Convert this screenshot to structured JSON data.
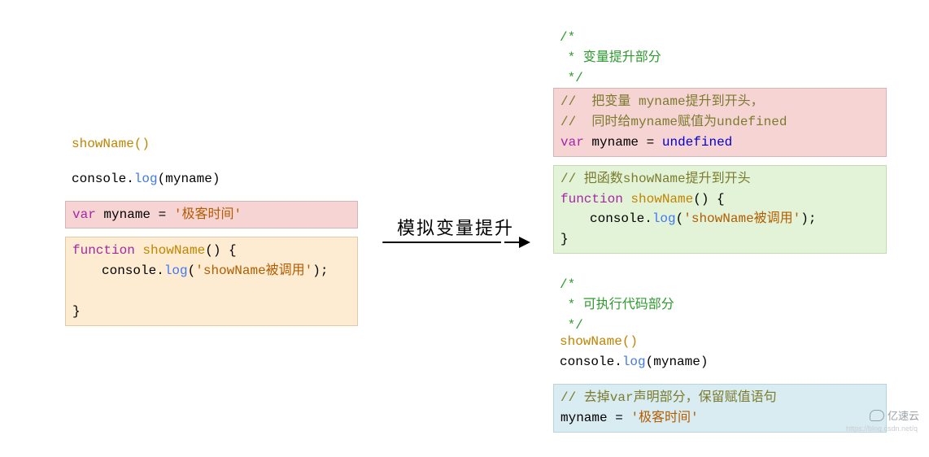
{
  "arrow_label": "模拟变量提升",
  "left": {
    "call1": "showName()",
    "log": {
      "prefix": "console",
      "method": "log",
      "arg": "myname"
    },
    "var_line": {
      "kw": "var",
      "name": "myname",
      "eq": "=",
      "str": "'极客时间'"
    },
    "func": {
      "kw": "function",
      "name": "showName",
      "open": "() {",
      "body_prefix": "console",
      "body_method": "log",
      "body_arg": "'showName被调用'",
      "close": "}"
    }
  },
  "right": {
    "hoist_comment": {
      "l1": "/*",
      "l2": " * 变量提升部分",
      "l3": " */"
    },
    "pink": {
      "c1": "//  把变量 myname提升到开头，",
      "c2": "//  同时给myname赋值为undefined",
      "kw": "var",
      "name": "myname",
      "eq": "=",
      "val": "undefined"
    },
    "green": {
      "c1": "// 把函数showName提升到开头",
      "kw": "function",
      "name": "showName",
      "open": "() {",
      "body_prefix": "console",
      "body_method": "log",
      "body_arg": "'showName被调用'",
      "close": "}"
    },
    "exec_comment": {
      "l1": "/*",
      "l2": " * 可执行代码部分",
      "l3": " */"
    },
    "call1": "showName()",
    "log": {
      "prefix": "console",
      "method": "log",
      "arg": "myname"
    },
    "blue": {
      "c1": "// 去掉var声明部分，保留赋值语句",
      "name": "myname",
      "eq": "=",
      "str": "'极客时间'"
    }
  },
  "watermark": {
    "text": "亿速云",
    "sub": "https://blog.csdn.net/q"
  }
}
